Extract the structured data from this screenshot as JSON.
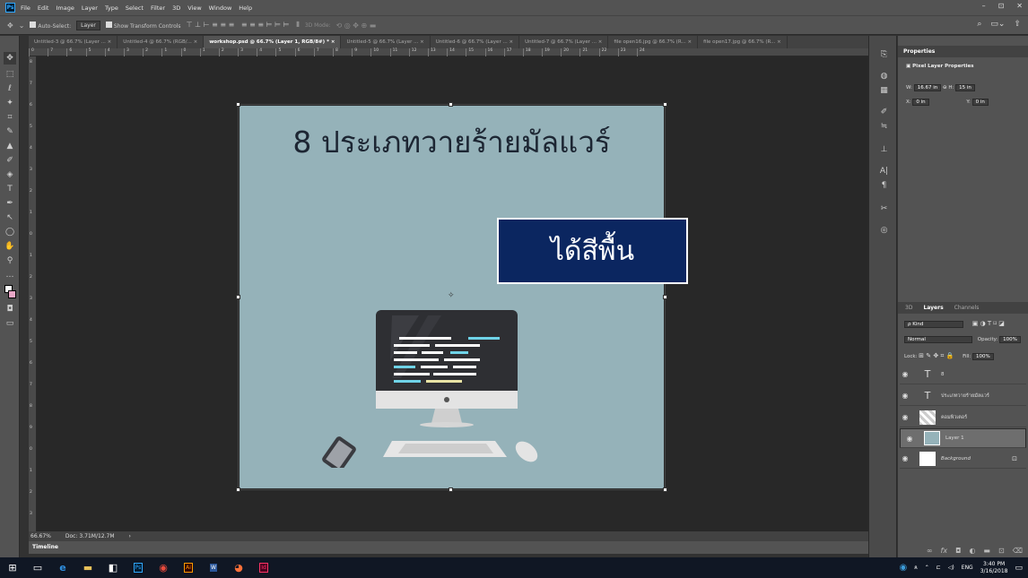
{
  "menu": [
    "File",
    "Edit",
    "Image",
    "Layer",
    "Type",
    "Select",
    "Filter",
    "3D",
    "View",
    "Window",
    "Help"
  ],
  "app_logo": "Ps",
  "window_controls": [
    "–",
    "⊡",
    "✕"
  ],
  "options": {
    "auto_select": "Auto-Select:",
    "auto_select_target": "Layer",
    "show_transform": "Show Transform Controls",
    "mode_3d": "3D Mode:"
  },
  "tabs": [
    "Untitled-3 @ 66.7% (Layer ... ×",
    "Untitled-4 @ 66.7% (RGB/... ×",
    "workshop.psd @ 66.7% (Layer 1, RGB/8#) * ×",
    "Untitled-5 @ 66.7% (Layer ... ×",
    "Untitled-6 @ 66.7% (Layer ... ×",
    "Untitled-7 @ 66.7% (Layer ... ×",
    "file open16.jpg @ 66.7% (R... ×",
    "file open17.jpg @ 66.7% (R... ×"
  ],
  "ruler_top": [
    "0",
    "7",
    "6",
    "5",
    "4",
    "3",
    "2",
    "1",
    "0",
    "1",
    "2",
    "3",
    "4",
    "5",
    "6",
    "7",
    "8",
    "9",
    "10",
    "11",
    "12",
    "13",
    "14",
    "15",
    "16",
    "17",
    "18",
    "19",
    "20",
    "21",
    "22",
    "23",
    "24"
  ],
  "ruler_left": [
    "8",
    "7",
    "6",
    "5",
    "4",
    "3",
    "2",
    "1",
    "0",
    "1",
    "2",
    "3",
    "4",
    "5",
    "6",
    "7",
    "8",
    "9",
    "0",
    "1",
    "2",
    "3"
  ],
  "doc": {
    "title": "8 ประเภทวายร้ายมัลแวร์",
    "fill_box": "ได้สีพื้น",
    "bg_color": "#95b2b9",
    "box_color": "#0b2660"
  },
  "status": {
    "zoom": "66.67%",
    "doc_size": "Doc: 3.71M/12.7M"
  },
  "timeline_label": "Timeline",
  "properties": {
    "tab": "Properties",
    "section": "Pixel Layer Properties",
    "w_label": "W:",
    "w_value": "16.67 in",
    "h_label": "H:",
    "h_value": "15 in",
    "x_label": "X:",
    "x_value": "0 in",
    "y_label": "Y:",
    "y_value": "0 in"
  },
  "layers_panel": {
    "tabs": [
      "3D",
      "Layers",
      "Channels"
    ],
    "filter_kind": "ρ Kind",
    "blend_mode": "Normal",
    "opacity_label": "Opacity:",
    "opacity_value": "100%",
    "lock_label": "Lock:",
    "fill_label": "Fill:",
    "fill_value": "100%",
    "layers": [
      {
        "type": "T",
        "name": "8"
      },
      {
        "type": "T",
        "name": "ประเภทวายร้ายมัลแวร์"
      },
      {
        "type": "img",
        "name": "คอมพิวเตอร์"
      },
      {
        "type": "img",
        "name": "Layer 1"
      },
      {
        "type": "bg",
        "name": "Background"
      }
    ]
  },
  "tray": {
    "lang": "ENG",
    "time": "3:40 PM",
    "date": "3/16/2018"
  }
}
